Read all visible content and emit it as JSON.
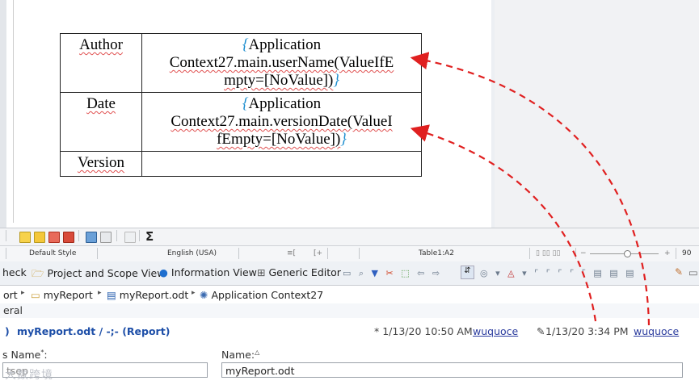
{
  "document": {
    "rows": [
      {
        "label": "Author",
        "value_line1": "Application",
        "value_line2": "Context27.main.userName(ValueIfE",
        "value_line3": "mpty=[NoValue])"
      },
      {
        "label": "Date",
        "value_line1": "Application",
        "value_line2": "Context27.main.versionDate(ValueI",
        "value_line3": "fEmpty=[NoValue])"
      },
      {
        "label": "Version",
        "value_line1": "",
        "value_line2": "",
        "value_line3": ""
      }
    ],
    "brace_open": "{",
    "brace_close": "}"
  },
  "toolbar": {
    "sigma": "Σ"
  },
  "statusbar": {
    "style": "Default Style",
    "language": "English (USA)",
    "cell": "Table1:A2",
    "zoom": "90"
  },
  "tabs": [
    {
      "label": "heck"
    },
    {
      "label": "Project and Scope View"
    },
    {
      "label": "Information View"
    },
    {
      "label": "Generic Editor"
    }
  ],
  "breadcrumb": [
    {
      "label": "ort"
    },
    {
      "label": "myReport"
    },
    {
      "label": "myReport.odt"
    },
    {
      "label": "Application Context27"
    }
  ],
  "section": {
    "title": "eral"
  },
  "editor": {
    "title": "myReport.odt / -;- (Report)",
    "created_time": "* 1/13/20 10:50 AM",
    "created_user": "wuquoce",
    "modified_time": "1/13/20 3:34 PM",
    "modified_user": "wuquoce",
    "left_label": "s Name",
    "right_label": "Name:",
    "left_value": "tsep",
    "name_value": "myReport.odt"
  },
  "watermark": "大数跨境",
  "colors": {
    "accent_blue": "#1e4fa8",
    "arrow_red": "#e02020",
    "brace_blue": "#1e8ecf"
  }
}
